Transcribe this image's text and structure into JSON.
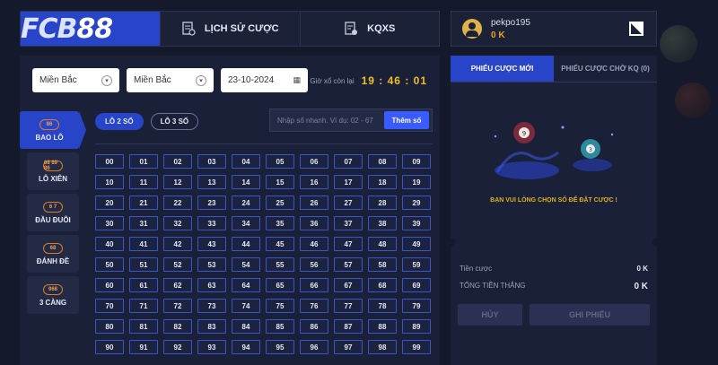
{
  "brand": {
    "logo_fc": "FCB",
    "logo_88": "88"
  },
  "nav": {
    "history": "LỊCH SỬ CƯỢC",
    "results": "KQXS"
  },
  "user": {
    "name": "pekpo195",
    "balance": "0 K"
  },
  "filters": {
    "region": "Miền Bắc",
    "station": "Miền Bắc",
    "date": "23-10-2024"
  },
  "countdown": {
    "label": "Giờ xổ còn lại",
    "time": "19 : 46 : 01"
  },
  "sidebar": [
    {
      "label": "BAO LÔ",
      "icon": "86",
      "active": true
    },
    {
      "label": "LÔ XIÊN",
      "icon": "68 89 86",
      "active": false
    },
    {
      "label": "ĐẦU ĐUÔI",
      "icon": "6 7",
      "active": false
    },
    {
      "label": "ĐÁNH ĐỀ",
      "icon": "68",
      "active": false
    },
    {
      "label": "3 CÀNG",
      "icon": "968",
      "active": false
    }
  ],
  "subtabs": [
    "LÔ 2 SỐ",
    "LÔ 3 SỐ"
  ],
  "quick": {
    "placeholder": "Nhập số nhanh. Ví dụ: 02 - 67",
    "button": "Thêm số"
  },
  "numbers": [
    "00",
    "01",
    "02",
    "03",
    "04",
    "05",
    "06",
    "07",
    "08",
    "09",
    "10",
    "11",
    "12",
    "13",
    "14",
    "15",
    "16",
    "17",
    "18",
    "19",
    "20",
    "21",
    "22",
    "23",
    "24",
    "25",
    "26",
    "27",
    "28",
    "29",
    "30",
    "31",
    "32",
    "33",
    "34",
    "35",
    "36",
    "37",
    "38",
    "39",
    "40",
    "41",
    "42",
    "43",
    "44",
    "45",
    "46",
    "47",
    "48",
    "49",
    "50",
    "51",
    "52",
    "53",
    "54",
    "55",
    "56",
    "57",
    "58",
    "59",
    "60",
    "61",
    "62",
    "63",
    "64",
    "65",
    "66",
    "67",
    "68",
    "69",
    "70",
    "71",
    "72",
    "73",
    "74",
    "75",
    "76",
    "77",
    "78",
    "79",
    "80",
    "81",
    "82",
    "83",
    "84",
    "85",
    "86",
    "87",
    "88",
    "89",
    "90",
    "91",
    "92",
    "93",
    "94",
    "95",
    "96",
    "97",
    "98",
    "99"
  ],
  "betslip": {
    "tab_new": "PHIẾU CƯỢC MỚI",
    "tab_pending": "PHIẾU CƯỢC CHỜ KQ (0)",
    "empty": "BẠN VUI LÒNG CHỌN SỐ ĐỂ ĐẶT CƯỢC !",
    "stake_label": "Tiền cược",
    "stake_value": "0 K",
    "win_label": "TỔNG TIỀN THẮNG",
    "win_value": "0 K",
    "cancel": "HỦY",
    "submit": "GHI PHIẾU"
  },
  "colors": {
    "accent": "#2845c9",
    "bg": "#14192b",
    "panel": "#1a2037",
    "highlight": "#f0c020"
  }
}
